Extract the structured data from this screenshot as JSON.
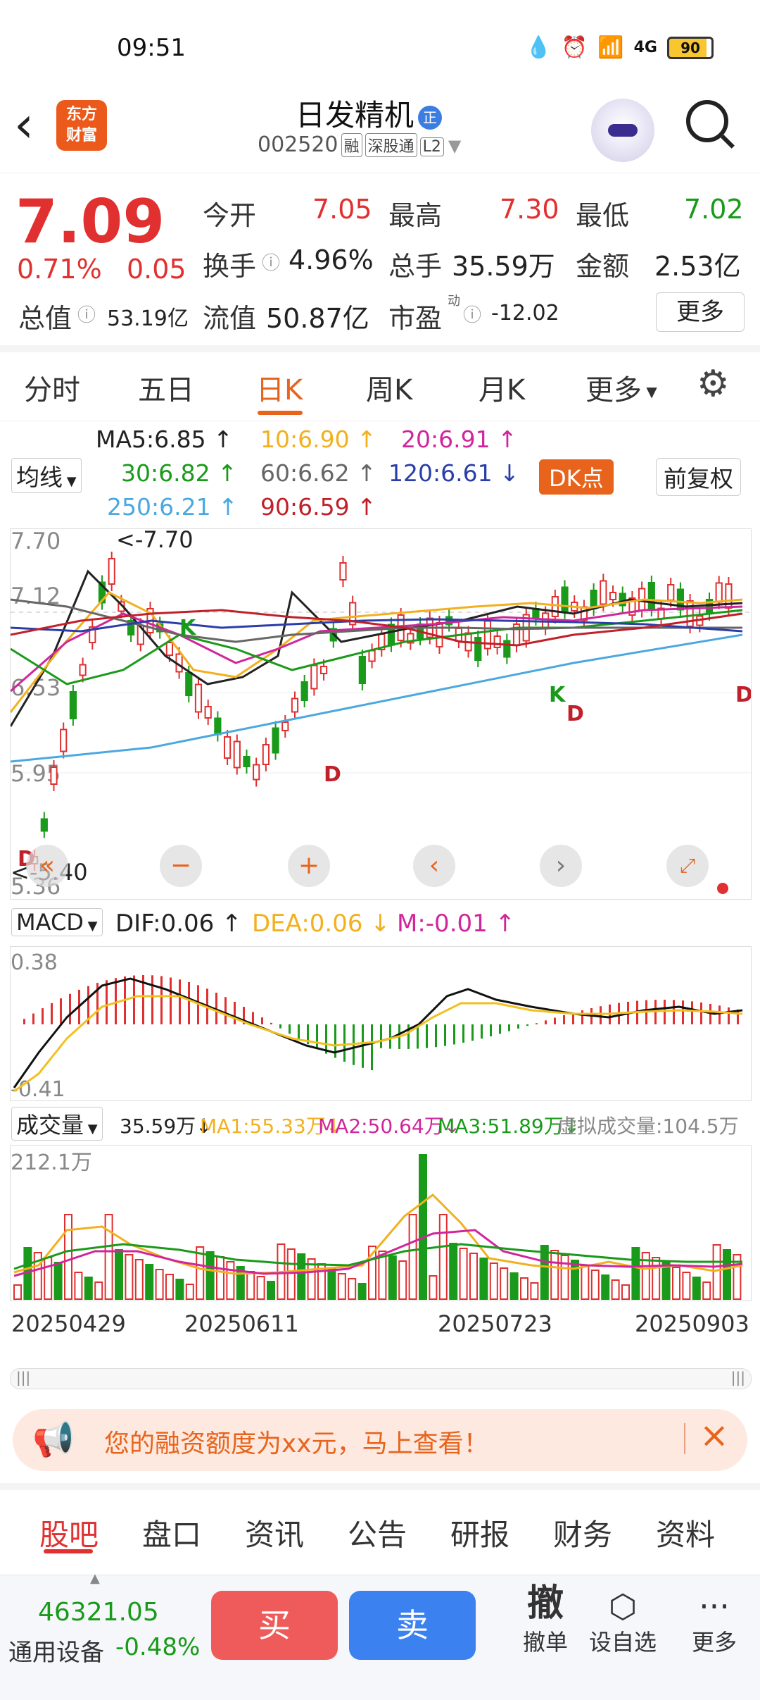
{
  "status": {
    "time": "09:51",
    "battery": "90",
    "net": "4G"
  },
  "header": {
    "logo": "东方\n财富",
    "name": "日发精机",
    "badge": "正",
    "code": "002520",
    "tags": [
      "融",
      "深股通",
      "L2"
    ]
  },
  "quote": {
    "price": "7.09",
    "pct": "0.71%",
    "change": "0.05",
    "open_lbl": "今开",
    "open": "7.05",
    "high_lbl": "最高",
    "high": "7.30",
    "low_lbl": "最低",
    "low": "7.02",
    "turnover_lbl": "换手",
    "turnover": "4.96%",
    "volume_lbl": "总手",
    "volume": "35.59万",
    "amount_lbl": "金额",
    "amount": "2.53亿",
    "mktcap_lbl": "总值",
    "mktcap": "53.19亿",
    "float_lbl": "流值",
    "float": "50.87亿",
    "pe_lbl": "市盈",
    "pe_sup": "动",
    "pe": "-12.02",
    "more": "更多"
  },
  "tabs": [
    "分时",
    "五日",
    "日K",
    "周K",
    "月K",
    "更多"
  ],
  "ma": {
    "select": "均线",
    "items": [
      {
        "t": "MA5:6.85 ↑",
        "c": "#222"
      },
      {
        "t": "10:6.90 ↑",
        "c": "#f2b01e"
      },
      {
        "t": "20:6.91 ↑",
        "c": "#d0269c"
      },
      {
        "t": "30:6.82 ↑",
        "c": "#1a9a1a"
      },
      {
        "t": "60:6.62 ↑",
        "c": "#666"
      },
      {
        "t": "120:6.61 ↓",
        "c": "#2b3ea8"
      },
      {
        "t": "250:6.21 ↑",
        "c": "#4aa8e0"
      },
      {
        "t": "90:6.59 ↑",
        "c": "#c0202a"
      }
    ],
    "dk": "DK点",
    "fuquan": "前复权"
  },
  "kchart": {
    "y_labels": [
      "7.70",
      "7.12",
      "6.53",
      "5.95",
      "5.36"
    ],
    "max_note": "<-7.70",
    "min_note": "<-5.40"
  },
  "macd": {
    "select": "MACD",
    "dif": "DIF:0.06 ↑",
    "dea": "DEA:0.06 ↓",
    "m": "M:-0.01 ↑",
    "top": "0.38",
    "bottom": "-0.41"
  },
  "volume": {
    "select": "成交量",
    "v": "35.59万↓",
    "ma1": "MA1:55.33万↓",
    "ma2": "MA2:50.64万↓",
    "ma3": "MA3:51.89万↓",
    "virt": "虚拟成交量:104.5万",
    "max": "212.1万"
  },
  "dates": [
    "20250429",
    "20250611",
    "20250723",
    "20250903"
  ],
  "banner": "您的融资额度为xx元，马上查看！",
  "bottom_tabs": [
    "股吧",
    "盘口",
    "资讯",
    "公告",
    "研报",
    "财务",
    "资料"
  ],
  "footer": {
    "index_val": "46321.05",
    "index_name": "通用设备",
    "index_chg": "-0.48%",
    "buy": "买",
    "sell": "卖",
    "cancel_big": "撤",
    "cancel": "撤单",
    "watch": "设自选",
    "more": "更多"
  },
  "colors": {
    "up": "#e03030",
    "down": "#1a9a1a",
    "accent": "#e8641c"
  }
}
